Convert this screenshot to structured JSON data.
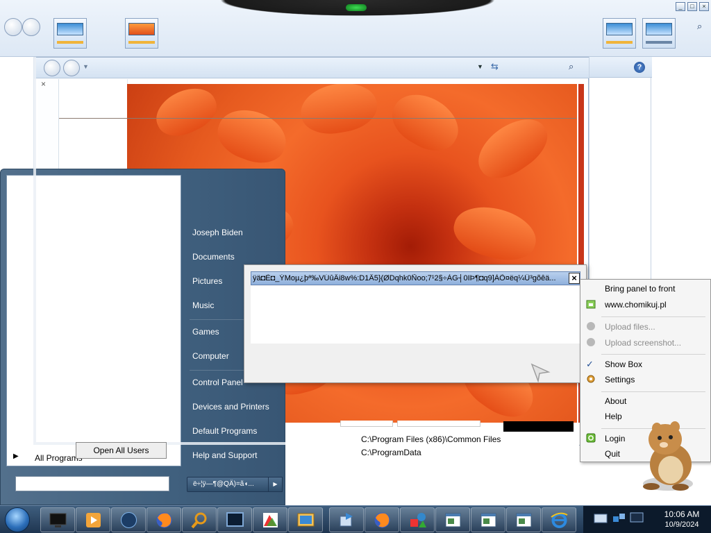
{
  "start_menu": {
    "items": [
      {
        "label": "Joseph Biden"
      },
      {
        "label": "Documents"
      },
      {
        "label": "Pictures"
      },
      {
        "label": "Music"
      },
      {
        "label": "Games"
      },
      {
        "label": "Computer"
      },
      {
        "label": "Control Panel"
      },
      {
        "label": "Devices and Printers"
      },
      {
        "label": "Default Programs"
      },
      {
        "label": "Help and Support"
      }
    ],
    "all_programs_label": "All Programs",
    "search_placeholder": "",
    "shutdown_label": "ë÷¦ÿ—¶@QÄ)=ã◖..."
  },
  "dialog": {
    "open_all_users_label": "Open All Users"
  },
  "explorer": {
    "details": {
      "line1": "C:\\Program Files (x86)\\Common Files",
      "line2": "C:\\ProgramData"
    }
  },
  "popup": {
    "title": "ÿä◘È◘_ÝMoµ¿þª‰VÚûÂi8w%:D1Â5}(ØDqhk0Ñoo;7¹2§÷ÀG┤0IÞ¶◘q9]ÀÕ¤ëq¼Ü³gõêä...",
    "close_label": "×"
  },
  "context_menu": {
    "items": [
      {
        "label": "Bring panel to front",
        "disabled": false
      },
      {
        "label": "www.chomikuj.pl",
        "disabled": false
      },
      {
        "label": "Upload files...",
        "disabled": true
      },
      {
        "label": "Upload screenshot...",
        "disabled": true
      },
      {
        "label": "Show Box",
        "disabled": false,
        "checked": true
      },
      {
        "label": "Settings",
        "disabled": false
      },
      {
        "label": "About",
        "disabled": false
      },
      {
        "label": "Help",
        "disabled": false
      },
      {
        "label": "Login",
        "disabled": false
      },
      {
        "label": "Quit",
        "disabled": false
      }
    ]
  },
  "taskbar": {
    "clock_time": "10:06 AM",
    "clock_date": "10/9/2024",
    "buttons": [
      {
        "icon": "monitor-icon"
      },
      {
        "icon": "media-player-icon"
      },
      {
        "icon": "globe-icon"
      },
      {
        "icon": "firefox-icon"
      },
      {
        "icon": "magnifier-icon"
      },
      {
        "icon": "screen-icon"
      },
      {
        "icon": "paint-icon"
      },
      {
        "icon": "picture-viewer-icon"
      },
      {
        "icon": "network-transfer-icon"
      },
      {
        "icon": "firefox-icon"
      },
      {
        "icon": "shapes-icon"
      },
      {
        "icon": "window-icon"
      },
      {
        "icon": "window-icon"
      },
      {
        "icon": "window-icon"
      },
      {
        "icon": "internet-explorer-icon"
      }
    ]
  },
  "colors": {
    "start_menu_bg": "#40607e",
    "taskbar_bg": "#1f3550",
    "flower_orange": "#f46b2b",
    "popup_title": "#8fb0dc"
  }
}
